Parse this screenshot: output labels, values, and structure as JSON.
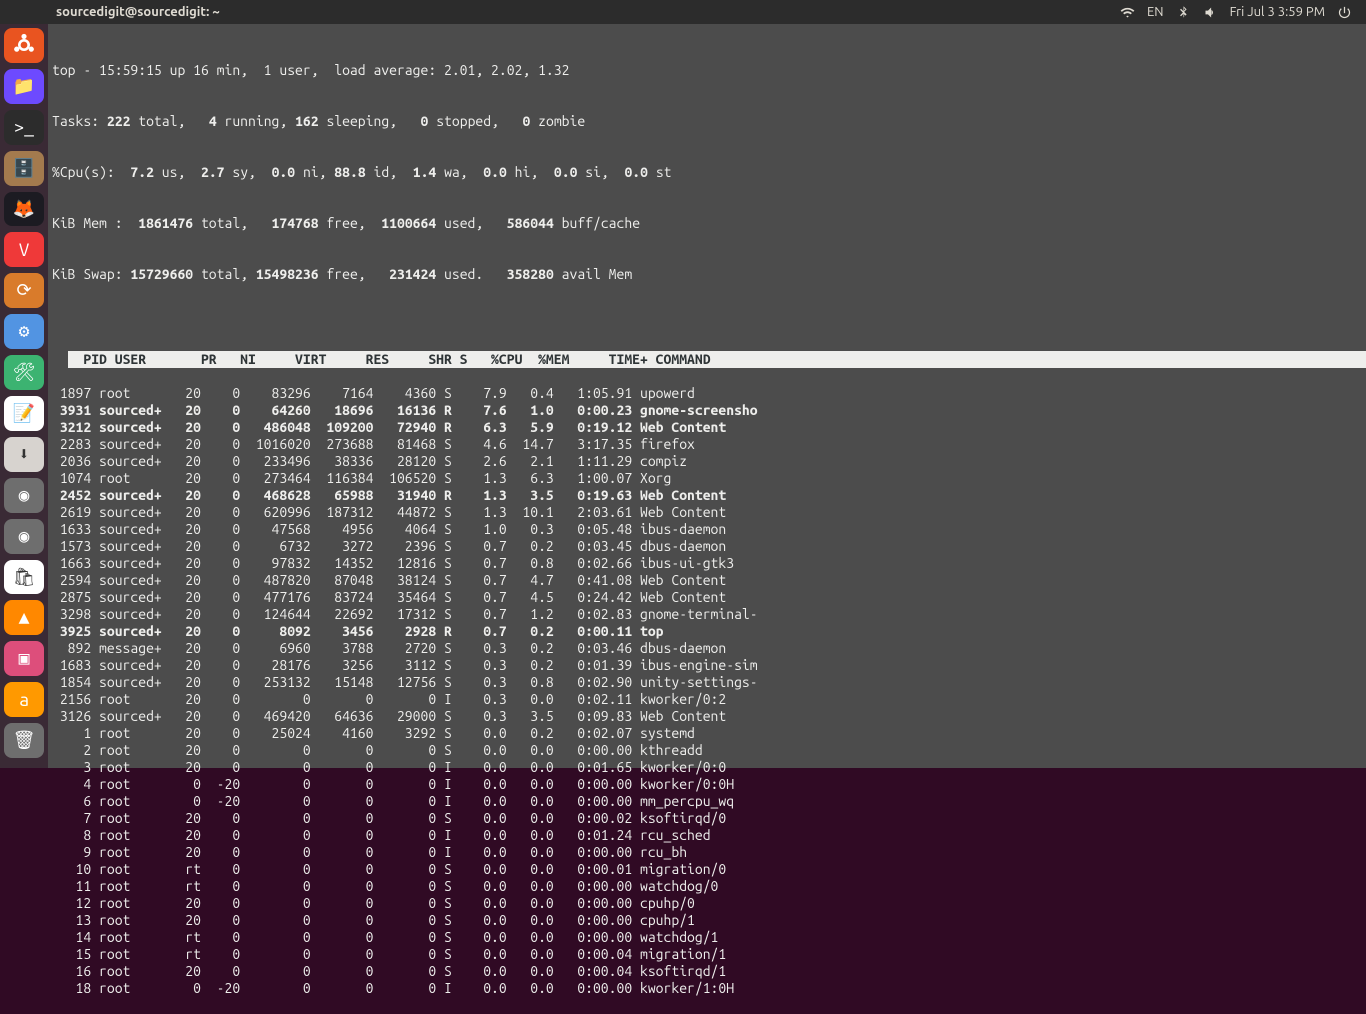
{
  "panel": {
    "title": "sourcedigit@sourcedigit: ~",
    "lang": "EN",
    "clock": "Fri Jul 3  3:59 PM"
  },
  "launcher": {
    "items": [
      {
        "name": "show-apps",
        "glyph": "ubuntu"
      },
      {
        "name": "files",
        "glyph": "📁",
        "bg": "#6d4aff"
      },
      {
        "name": "terminal",
        "glyph": ">_",
        "bg": "#2c2c2c"
      },
      {
        "name": "nautilus",
        "glyph": "🗄️",
        "bg": "#a37a4e"
      },
      {
        "name": "firefox",
        "glyph": "🦊",
        "bg": "#1c1b22"
      },
      {
        "name": "vivaldi",
        "glyph": "V",
        "bg": "#ef3939"
      },
      {
        "name": "updater",
        "glyph": "⟳",
        "bg": "#d97b2b"
      },
      {
        "name": "settings",
        "glyph": "⚙",
        "bg": "#5294e2"
      },
      {
        "name": "tweaks",
        "glyph": "🛠",
        "bg": "#3cb371"
      },
      {
        "name": "text-edit",
        "glyph": "📝",
        "bg": "#ffffff"
      },
      {
        "name": "archive",
        "glyph": "⬇",
        "bg": "#d7d3cf"
      },
      {
        "name": "disk1",
        "glyph": "◉",
        "bg": "#6e6e6e"
      },
      {
        "name": "disk2",
        "glyph": "◉",
        "bg": "#6e6e6e"
      },
      {
        "name": "software",
        "glyph": "🛍",
        "bg": "#ffffff"
      },
      {
        "name": "vlc",
        "glyph": "▲",
        "bg": "#ff8800"
      },
      {
        "name": "screenshot",
        "glyph": "▣",
        "bg": "#dd4e7b"
      },
      {
        "name": "amazon",
        "glyph": "a",
        "bg": "#ff9900"
      }
    ],
    "trash_glyph": "🗑"
  },
  "top": {
    "line1_a": "top - 15:59:15 up 16 min,  1 user,  load average: 2.01, 2.02, 1.32",
    "tasks_label": "Tasks:",
    "tasks_total": " 222 ",
    "tasks_total_l": "total,",
    "tasks_run": "   4 ",
    "tasks_run_l": "running,",
    "tasks_sleep": " 162 ",
    "tasks_sleep_l": "sleeping,",
    "tasks_stop": "   0 ",
    "tasks_stop_l": "stopped,",
    "tasks_zomb": "   0 ",
    "tasks_zomb_l": "zombie",
    "cpu_label": "%Cpu(s):",
    "cpu_us": "  7.2 ",
    "cpu_us_l": "us,",
    "cpu_sy": "  2.7 ",
    "cpu_sy_l": "sy,",
    "cpu_ni": "  0.0 ",
    "cpu_ni_l": "ni,",
    "cpu_id": " 88.8 ",
    "cpu_id_l": "id,",
    "cpu_wa": "  1.4 ",
    "cpu_wa_l": "wa,",
    "cpu_hi": "  0.0 ",
    "cpu_hi_l": "hi,",
    "cpu_si": "  0.0 ",
    "cpu_si_l": "si,",
    "cpu_st": "  0.0 ",
    "cpu_st_l": "st",
    "mem_label": "KiB Mem :",
    "mem_total": "  1861476 ",
    "mem_total_l": "total,",
    "mem_free": "   174768 ",
    "mem_free_l": "free,",
    "mem_used": "  1100664 ",
    "mem_used_l": "used,",
    "mem_buf": "   586044 ",
    "mem_buf_l": "buff/cache",
    "swap_label": "KiB Swap:",
    "swap_total": " 15729660 ",
    "swap_total_l": "total,",
    "swap_free": " 15498236 ",
    "swap_free_l": "free,",
    "swap_used": "   231424 ",
    "swap_used_l": "used.",
    "swap_avail": "   358280 ",
    "swap_avail_l": "avail Mem"
  },
  "headers": {
    "pid": "PID",
    "user": "USER",
    "pr": "PR",
    "ni": "NI",
    "virt": "VIRT",
    "res": "RES",
    "shr": "SHR",
    "s": "S",
    "cpu": "%CPU",
    "mem": "%MEM",
    "time": "TIME+",
    "cmd": "COMMAND"
  },
  "rows": [
    {
      "pid": "1897",
      "user": "root",
      "pr": "20",
      "ni": "0",
      "virt": "83296",
      "res": "7164",
      "shr": "4360",
      "s": "S",
      "cpu": "7.9",
      "mem": "0.4",
      "time": "1:05.91",
      "cmd": "upowerd",
      "bold": false
    },
    {
      "pid": "3931",
      "user": "sourced+",
      "pr": "20",
      "ni": "0",
      "virt": "64260",
      "res": "18696",
      "shr": "16136",
      "s": "R",
      "cpu": "7.6",
      "mem": "1.0",
      "time": "0:00.23",
      "cmd": "gnome-screensho",
      "bold": true
    },
    {
      "pid": "3212",
      "user": "sourced+",
      "pr": "20",
      "ni": "0",
      "virt": "486048",
      "res": "109200",
      "shr": "72940",
      "s": "R",
      "cpu": "6.3",
      "mem": "5.9",
      "time": "0:19.12",
      "cmd": "Web Content",
      "bold": true
    },
    {
      "pid": "2283",
      "user": "sourced+",
      "pr": "20",
      "ni": "0",
      "virt": "1016020",
      "res": "273688",
      "shr": "81468",
      "s": "S",
      "cpu": "4.6",
      "mem": "14.7",
      "time": "3:17.35",
      "cmd": "firefox",
      "bold": false
    },
    {
      "pid": "2036",
      "user": "sourced+",
      "pr": "20",
      "ni": "0",
      "virt": "233496",
      "res": "38336",
      "shr": "28120",
      "s": "S",
      "cpu": "2.6",
      "mem": "2.1",
      "time": "1:11.29",
      "cmd": "compiz",
      "bold": false
    },
    {
      "pid": "1074",
      "user": "root",
      "pr": "20",
      "ni": "0",
      "virt": "273464",
      "res": "116384",
      "shr": "106520",
      "s": "S",
      "cpu": "1.3",
      "mem": "6.3",
      "time": "1:00.07",
      "cmd": "Xorg",
      "bold": false
    },
    {
      "pid": "2452",
      "user": "sourced+",
      "pr": "20",
      "ni": "0",
      "virt": "468628",
      "res": "65988",
      "shr": "31940",
      "s": "R",
      "cpu": "1.3",
      "mem": "3.5",
      "time": "0:19.63",
      "cmd": "Web Content",
      "bold": true
    },
    {
      "pid": "2619",
      "user": "sourced+",
      "pr": "20",
      "ni": "0",
      "virt": "620996",
      "res": "187312",
      "shr": "44872",
      "s": "S",
      "cpu": "1.3",
      "mem": "10.1",
      "time": "2:03.61",
      "cmd": "Web Content",
      "bold": false
    },
    {
      "pid": "1633",
      "user": "sourced+",
      "pr": "20",
      "ni": "0",
      "virt": "47568",
      "res": "4956",
      "shr": "4064",
      "s": "S",
      "cpu": "1.0",
      "mem": "0.3",
      "time": "0:05.48",
      "cmd": "ibus-daemon",
      "bold": false
    },
    {
      "pid": "1573",
      "user": "sourced+",
      "pr": "20",
      "ni": "0",
      "virt": "6732",
      "res": "3272",
      "shr": "2396",
      "s": "S",
      "cpu": "0.7",
      "mem": "0.2",
      "time": "0:03.45",
      "cmd": "dbus-daemon",
      "bold": false
    },
    {
      "pid": "1663",
      "user": "sourced+",
      "pr": "20",
      "ni": "0",
      "virt": "97832",
      "res": "14352",
      "shr": "12816",
      "s": "S",
      "cpu": "0.7",
      "mem": "0.8",
      "time": "0:02.66",
      "cmd": "ibus-ui-gtk3",
      "bold": false
    },
    {
      "pid": "2594",
      "user": "sourced+",
      "pr": "20",
      "ni": "0",
      "virt": "487820",
      "res": "87048",
      "shr": "38124",
      "s": "S",
      "cpu": "0.7",
      "mem": "4.7",
      "time": "0:41.08",
      "cmd": "Web Content",
      "bold": false
    },
    {
      "pid": "2875",
      "user": "sourced+",
      "pr": "20",
      "ni": "0",
      "virt": "477176",
      "res": "83724",
      "shr": "35464",
      "s": "S",
      "cpu": "0.7",
      "mem": "4.5",
      "time": "0:24.42",
      "cmd": "Web Content",
      "bold": false
    },
    {
      "pid": "3298",
      "user": "sourced+",
      "pr": "20",
      "ni": "0",
      "virt": "124644",
      "res": "22692",
      "shr": "17312",
      "s": "S",
      "cpu": "0.7",
      "mem": "1.2",
      "time": "0:02.83",
      "cmd": "gnome-terminal-",
      "bold": false
    },
    {
      "pid": "3925",
      "user": "sourced+",
      "pr": "20",
      "ni": "0",
      "virt": "8092",
      "res": "3456",
      "shr": "2928",
      "s": "R",
      "cpu": "0.7",
      "mem": "0.2",
      "time": "0:00.11",
      "cmd": "top",
      "bold": true
    },
    {
      "pid": "892",
      "user": "message+",
      "pr": "20",
      "ni": "0",
      "virt": "6960",
      "res": "3788",
      "shr": "2720",
      "s": "S",
      "cpu": "0.3",
      "mem": "0.2",
      "time": "0:03.46",
      "cmd": "dbus-daemon",
      "bold": false
    },
    {
      "pid": "1683",
      "user": "sourced+",
      "pr": "20",
      "ni": "0",
      "virt": "28176",
      "res": "3256",
      "shr": "3112",
      "s": "S",
      "cpu": "0.3",
      "mem": "0.2",
      "time": "0:01.39",
      "cmd": "ibus-engine-sim",
      "bold": false
    },
    {
      "pid": "1854",
      "user": "sourced+",
      "pr": "20",
      "ni": "0",
      "virt": "253132",
      "res": "15148",
      "shr": "12756",
      "s": "S",
      "cpu": "0.3",
      "mem": "0.8",
      "time": "0:02.90",
      "cmd": "unity-settings-",
      "bold": false
    },
    {
      "pid": "2156",
      "user": "root",
      "pr": "20",
      "ni": "0",
      "virt": "0",
      "res": "0",
      "shr": "0",
      "s": "I",
      "cpu": "0.3",
      "mem": "0.0",
      "time": "0:02.11",
      "cmd": "kworker/0:2",
      "bold": false
    },
    {
      "pid": "3126",
      "user": "sourced+",
      "pr": "20",
      "ni": "0",
      "virt": "469420",
      "res": "64636",
      "shr": "29000",
      "s": "S",
      "cpu": "0.3",
      "mem": "3.5",
      "time": "0:09.83",
      "cmd": "Web Content",
      "bold": false
    },
    {
      "pid": "1",
      "user": "root",
      "pr": "20",
      "ni": "0",
      "virt": "25024",
      "res": "4160",
      "shr": "3292",
      "s": "S",
      "cpu": "0.0",
      "mem": "0.2",
      "time": "0:02.07",
      "cmd": "systemd",
      "bold": false
    },
    {
      "pid": "2",
      "user": "root",
      "pr": "20",
      "ni": "0",
      "virt": "0",
      "res": "0",
      "shr": "0",
      "s": "S",
      "cpu": "0.0",
      "mem": "0.0",
      "time": "0:00.00",
      "cmd": "kthreadd",
      "bold": false
    },
    {
      "pid": "3",
      "user": "root",
      "pr": "20",
      "ni": "0",
      "virt": "0",
      "res": "0",
      "shr": "0",
      "s": "I",
      "cpu": "0.0",
      "mem": "0.0",
      "time": "0:01.65",
      "cmd": "kworker/0:0",
      "bold": false
    },
    {
      "pid": "4",
      "user": "root",
      "pr": "0",
      "ni": "-20",
      "virt": "0",
      "res": "0",
      "shr": "0",
      "s": "I",
      "cpu": "0.0",
      "mem": "0.0",
      "time": "0:00.00",
      "cmd": "kworker/0:0H",
      "bold": false
    },
    {
      "pid": "6",
      "user": "root",
      "pr": "0",
      "ni": "-20",
      "virt": "0",
      "res": "0",
      "shr": "0",
      "s": "I",
      "cpu": "0.0",
      "mem": "0.0",
      "time": "0:00.00",
      "cmd": "mm_percpu_wq",
      "bold": false
    },
    {
      "pid": "7",
      "user": "root",
      "pr": "20",
      "ni": "0",
      "virt": "0",
      "res": "0",
      "shr": "0",
      "s": "S",
      "cpu": "0.0",
      "mem": "0.0",
      "time": "0:00.02",
      "cmd": "ksoftirqd/0",
      "bold": false
    },
    {
      "pid": "8",
      "user": "root",
      "pr": "20",
      "ni": "0",
      "virt": "0",
      "res": "0",
      "shr": "0",
      "s": "I",
      "cpu": "0.0",
      "mem": "0.0",
      "time": "0:01.24",
      "cmd": "rcu_sched",
      "bold": false
    },
    {
      "pid": "9",
      "user": "root",
      "pr": "20",
      "ni": "0",
      "virt": "0",
      "res": "0",
      "shr": "0",
      "s": "I",
      "cpu": "0.0",
      "mem": "0.0",
      "time": "0:00.00",
      "cmd": "rcu_bh",
      "bold": false
    },
    {
      "pid": "10",
      "user": "root",
      "pr": "rt",
      "ni": "0",
      "virt": "0",
      "res": "0",
      "shr": "0",
      "s": "S",
      "cpu": "0.0",
      "mem": "0.0",
      "time": "0:00.01",
      "cmd": "migration/0",
      "bold": false
    },
    {
      "pid": "11",
      "user": "root",
      "pr": "rt",
      "ni": "0",
      "virt": "0",
      "res": "0",
      "shr": "0",
      "s": "S",
      "cpu": "0.0",
      "mem": "0.0",
      "time": "0:00.00",
      "cmd": "watchdog/0",
      "bold": false
    },
    {
      "pid": "12",
      "user": "root",
      "pr": "20",
      "ni": "0",
      "virt": "0",
      "res": "0",
      "shr": "0",
      "s": "S",
      "cpu": "0.0",
      "mem": "0.0",
      "time": "0:00.00",
      "cmd": "cpuhp/0",
      "bold": false
    },
    {
      "pid": "13",
      "user": "root",
      "pr": "20",
      "ni": "0",
      "virt": "0",
      "res": "0",
      "shr": "0",
      "s": "S",
      "cpu": "0.0",
      "mem": "0.0",
      "time": "0:00.00",
      "cmd": "cpuhp/1",
      "bold": false
    },
    {
      "pid": "14",
      "user": "root",
      "pr": "rt",
      "ni": "0",
      "virt": "0",
      "res": "0",
      "shr": "0",
      "s": "S",
      "cpu": "0.0",
      "mem": "0.0",
      "time": "0:00.00",
      "cmd": "watchdog/1",
      "bold": false
    },
    {
      "pid": "15",
      "user": "root",
      "pr": "rt",
      "ni": "0",
      "virt": "0",
      "res": "0",
      "shr": "0",
      "s": "S",
      "cpu": "0.0",
      "mem": "0.0",
      "time": "0:00.04",
      "cmd": "migration/1",
      "bold": false
    },
    {
      "pid": "16",
      "user": "root",
      "pr": "20",
      "ni": "0",
      "virt": "0",
      "res": "0",
      "shr": "0",
      "s": "S",
      "cpu": "0.0",
      "mem": "0.0",
      "time": "0:00.04",
      "cmd": "ksoftirqd/1",
      "bold": false
    },
    {
      "pid": "18",
      "user": "root",
      "pr": "0",
      "ni": "-20",
      "virt": "0",
      "res": "0",
      "shr": "0",
      "s": "I",
      "cpu": "0.0",
      "mem": "0.0",
      "time": "0:00.00",
      "cmd": "kworker/1:0H",
      "bold": false
    }
  ]
}
